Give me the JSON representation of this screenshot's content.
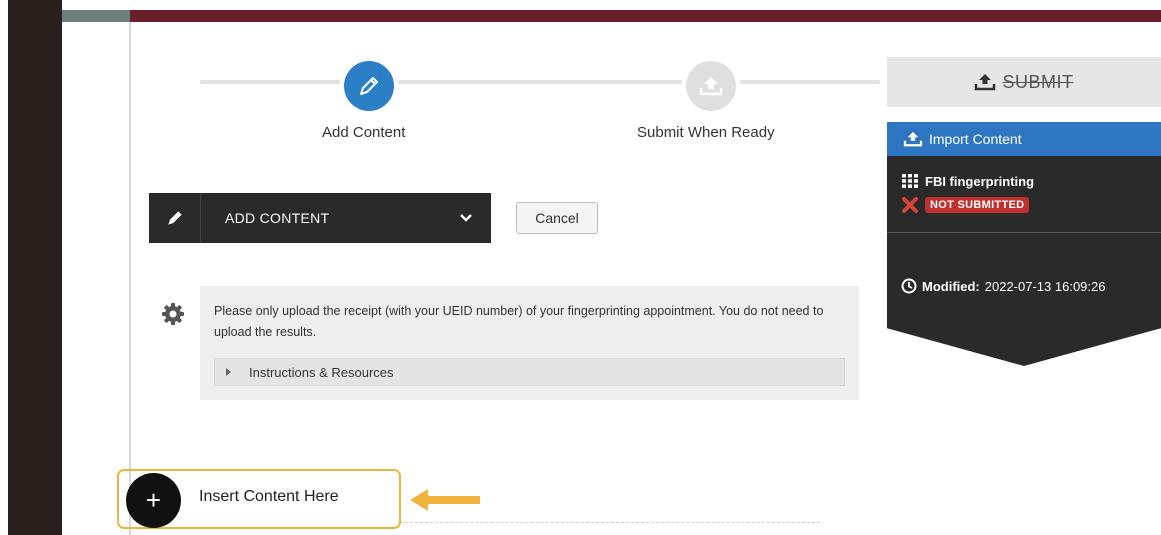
{
  "colors": {
    "top_bar": "#6b1f2a",
    "accent_blue": "#2b7fc6",
    "import_bar": "#2e76c2",
    "panel_dark": "#2a2a2a",
    "badge_red": "#c0302f",
    "highlight": "#f0b43c"
  },
  "stepper": {
    "steps": [
      {
        "label": "Add Content",
        "icon": "pencil-icon",
        "state": "active"
      },
      {
        "label": "Submit When Ready",
        "icon": "upload-icon",
        "state": "inactive"
      }
    ]
  },
  "submit_button": {
    "label": "SUBMIT",
    "icon": "upload-icon",
    "disabled": true
  },
  "side_panel": {
    "import_label": "Import Content",
    "item_title": "FBI fingerprinting",
    "item_icon": "grid-icon",
    "status_icon": "x-icon",
    "status_badge": "NOT SUBMITTED",
    "modified_label": "Modified:",
    "modified_value": "2022-07-13 16:09:26"
  },
  "toolbar": {
    "add_content_label": "ADD CONTENT",
    "cancel_label": "Cancel"
  },
  "instructions": {
    "text": "Please only upload the receipt (with your UEID number) of your fingerprinting appointment. You do not need to upload the results.",
    "toggle_label": "Instructions & Resources"
  },
  "insert": {
    "label": "Insert Content Here",
    "icon_glyph": "+"
  }
}
